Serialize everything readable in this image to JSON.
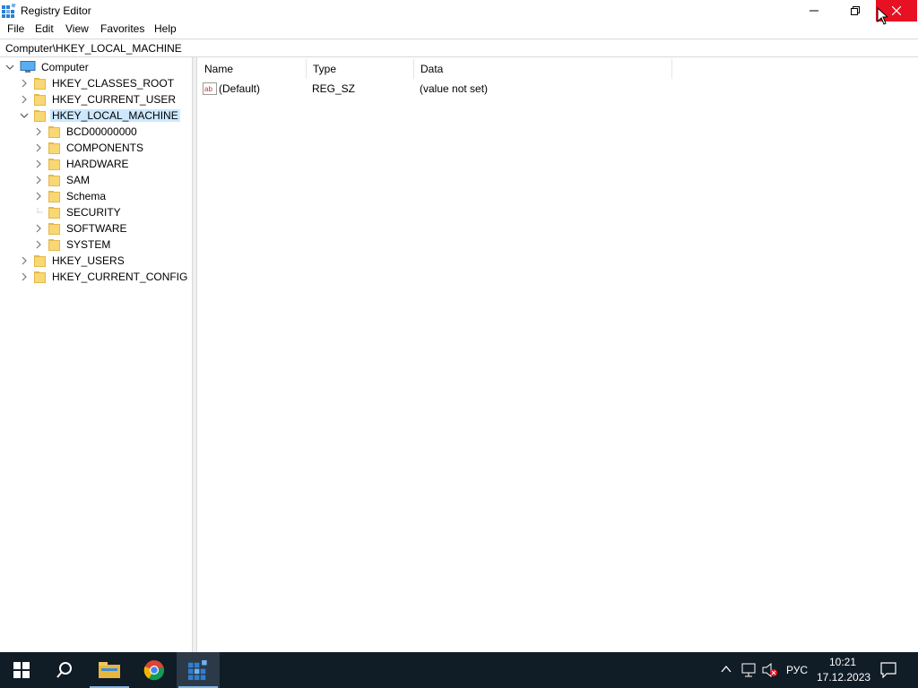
{
  "window": {
    "title": "Registry Editor"
  },
  "menu": [
    "File",
    "Edit",
    "View",
    "Favorites",
    "Help"
  ],
  "address": "Computer\\HKEY_LOCAL_MACHINE",
  "tree": {
    "root": "Computer",
    "hives": {
      "classes_root": "HKEY_CLASSES_ROOT",
      "current_user": "HKEY_CURRENT_USER",
      "local_machine": "HKEY_LOCAL_MACHINE",
      "users": "HKEY_USERS",
      "current_config": "HKEY_CURRENT_CONFIG"
    },
    "local_machine_children": [
      "BCD00000000",
      "COMPONENTS",
      "HARDWARE",
      "SAM",
      "Schema",
      "SECURITY",
      "SOFTWARE",
      "SYSTEM"
    ]
  },
  "list": {
    "columns": [
      "Name",
      "Type",
      "Data"
    ],
    "rows": [
      {
        "name": "(Default)",
        "type": "REG_SZ",
        "data": "(value not set)",
        "icon": "string-value-icon"
      }
    ]
  },
  "taskbar": {
    "apps": [
      "start-icon",
      "search-icon",
      "file-explorer-icon",
      "chrome-icon",
      "registry-editor-icon"
    ],
    "language": "РУС",
    "time": "10:21",
    "date": "17.12.2023"
  },
  "colors": {
    "close_button": "#e81123",
    "selection": "#cce8ff",
    "taskbar": "#101c26"
  }
}
